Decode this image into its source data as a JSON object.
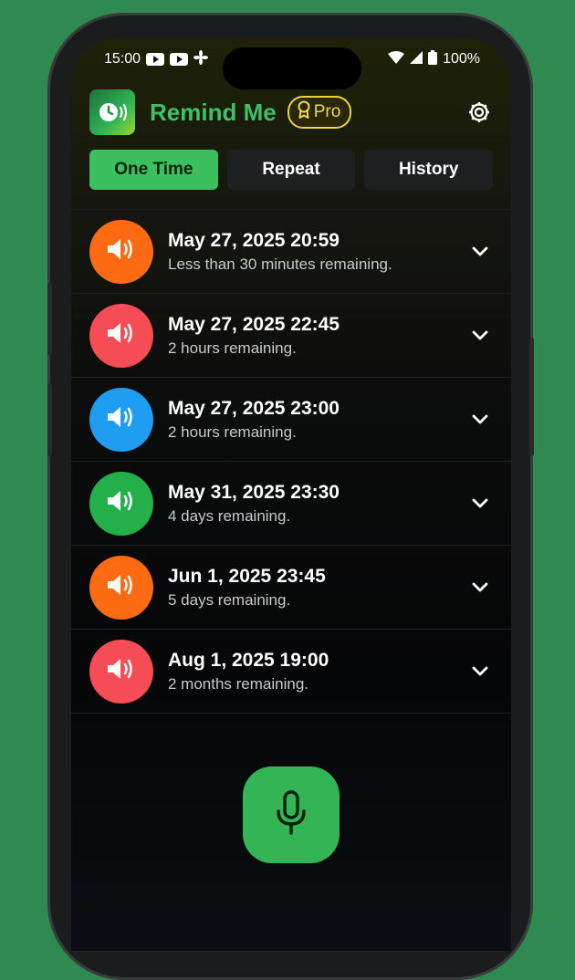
{
  "status_bar": {
    "time": "15:00",
    "battery": "100%"
  },
  "header": {
    "app_title": "Remind Me",
    "pro_label": "Pro"
  },
  "tabs": [
    {
      "label": "One Time",
      "active": true
    },
    {
      "label": "Repeat",
      "active": false
    },
    {
      "label": "History",
      "active": false
    }
  ],
  "reminders": [
    {
      "datetime": "May 27, 2025 20:59",
      "remaining": "Less than 30 minutes remaining.",
      "color": "#ff6b12"
    },
    {
      "datetime": "May 27, 2025 22:45",
      "remaining": "2 hours remaining.",
      "color": "#f64c55"
    },
    {
      "datetime": "May 27, 2025 23:00",
      "remaining": "2 hours remaining.",
      "color": "#1f9df0"
    },
    {
      "datetime": "May 31, 2025 23:30",
      "remaining": "4 days remaining.",
      "color": "#23b04a"
    },
    {
      "datetime": "Jun 1, 2025 23:45",
      "remaining": "5 days remaining.",
      "color": "#ff6b12"
    },
    {
      "datetime": "Aug 1, 2025 19:00",
      "remaining": "2 months remaining.",
      "color": "#f64c55"
    }
  ],
  "icons": {
    "app": "clock-sound-icon",
    "pro": "badge-icon",
    "settings": "gear-icon",
    "row": "speaker-icon",
    "expand": "chevron-down-icon",
    "voice": "microphone-icon"
  },
  "colors": {
    "accent": "#3bbf5f",
    "pro": "#f0d94d"
  }
}
